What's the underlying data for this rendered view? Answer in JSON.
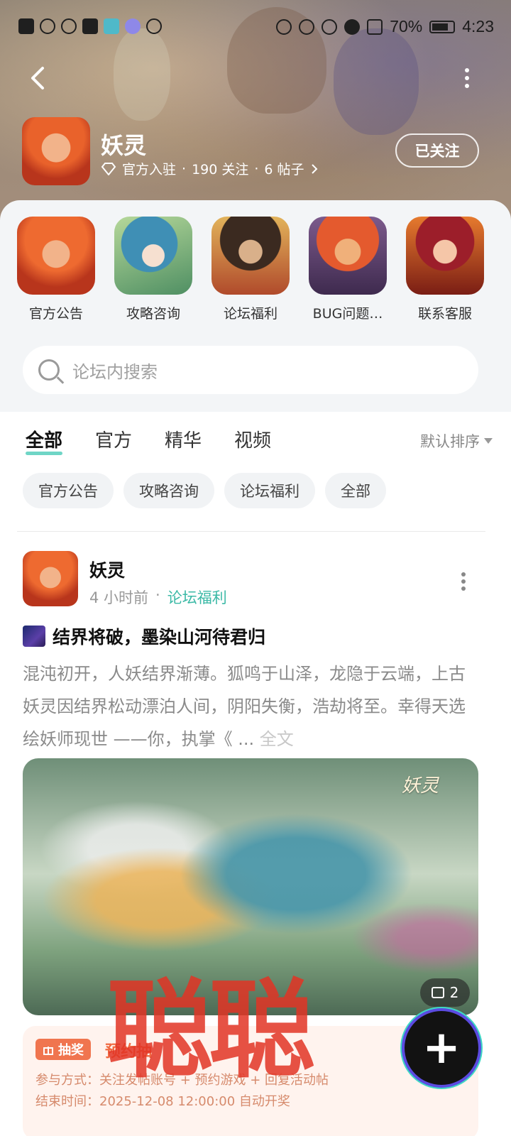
{
  "status_bar": {
    "battery": "70%",
    "time": "4:23"
  },
  "header": {
    "forum_name": "妖灵",
    "meta_official": "官方入驻",
    "meta_follow": "190 关注",
    "meta_posts": "6 帖子",
    "follow_label": "已关注"
  },
  "categories": [
    {
      "label": "官方公告"
    },
    {
      "label": "攻略咨询"
    },
    {
      "label": "论坛福利"
    },
    {
      "label": "BUG问题…"
    },
    {
      "label": "联系客服"
    }
  ],
  "search": {
    "placeholder": "论坛内搜索"
  },
  "tabs": [
    {
      "label": "全部",
      "active": true
    },
    {
      "label": "官方"
    },
    {
      "label": "精华"
    },
    {
      "label": "视频"
    }
  ],
  "sort_label": "默认排序",
  "chips": [
    {
      "label": "官方公告"
    },
    {
      "label": "攻略咨询"
    },
    {
      "label": "论坛福利"
    },
    {
      "label": "全部"
    }
  ],
  "post": {
    "author": "妖灵",
    "time": "4 小时前",
    "category": "论坛福利",
    "title": "结界将破，墨染山河待君归",
    "body": "混沌初开，人妖结界渐薄。狐鸣于山泽，龙隐于云端，上古妖灵因结界松动漂泊人间，阴阳失衡，浩劫将至。幸得天选绘妖师现世 ——你，执掌《 ...",
    "full_text": "全文",
    "image_logo": "妖灵",
    "image_count": "2",
    "lottery": {
      "tag": "抽奖",
      "title": "预约抽",
      "join": "参与方式：关注发帖账号 + 预约游戏 + 回复活动帖",
      "end": "结束时间：2025-12-08 12:00:00 自动开奖"
    }
  },
  "watermark": "聪聪",
  "fab_label": "+"
}
